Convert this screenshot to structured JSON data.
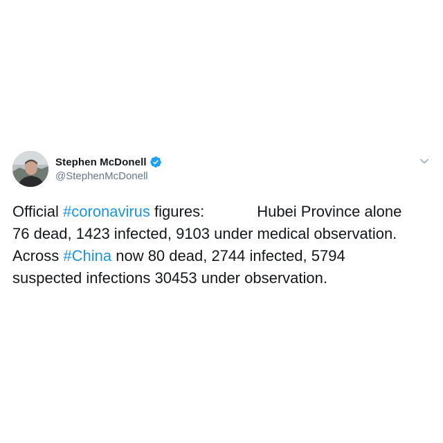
{
  "tweet": {
    "author": {
      "display_name": "Stephen McDonell",
      "handle": "@StephenMcDonell",
      "verified": true,
      "avatar_icon": "profile-photo"
    },
    "menu_icon": "chevron-down-icon",
    "body": {
      "line1_pre": "Official",
      "hashtag_coronavirus": "#coronavirus",
      "line1_mid": "figures:",
      "line1_post": "Hubei Province alone",
      "line2": "76 dead, 1423 infected, 9103 under medical observation.",
      "line3_pre": "Across",
      "hashtag_china": "#China",
      "line3_post": "now 80 dead, 2744 infected, 5794",
      "line4": "suspected infections 30453 under observation."
    },
    "colors": {
      "text": "#14171a",
      "secondary": "#657786",
      "link": "#1b95e0",
      "verified_badge": "#1da1f2"
    }
  }
}
